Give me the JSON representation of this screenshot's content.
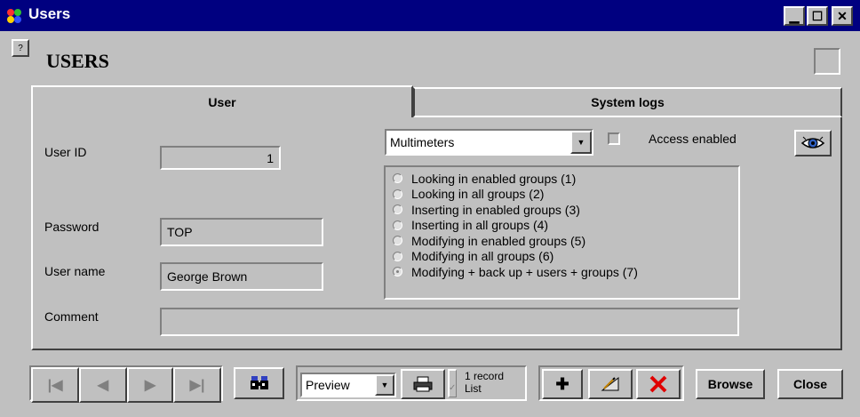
{
  "window": {
    "title": "Users"
  },
  "header": {
    "title": "USERS"
  },
  "tabs": [
    {
      "label": "User"
    },
    {
      "label": "System logs"
    }
  ],
  "form": {
    "user_id_label": "User ID",
    "user_id_value": "1",
    "password_label": "Password",
    "password_value": "TOP",
    "user_name_label": "User name",
    "user_name_value": "George Brown",
    "comment_label": "Comment",
    "comment_value": ""
  },
  "permissions": {
    "group_select_value": "Multimeters",
    "access_enabled_label": "Access enabled",
    "access_enabled_checked": false,
    "options": [
      {
        "label": "Looking in enabled groups (1)",
        "checked": false
      },
      {
        "label": "Looking in all groups (2)",
        "checked": false
      },
      {
        "label": "Inserting in enabled groups (3)",
        "checked": false
      },
      {
        "label": "Inserting in all groups (4)",
        "checked": false
      },
      {
        "label": "Modifying in enabled groups (5)",
        "checked": false
      },
      {
        "label": "Modifying in all groups (6)",
        "checked": false
      },
      {
        "label": "Modifying + back up + users + groups (7)",
        "checked": true
      }
    ]
  },
  "toolbar": {
    "report_select_value": "Preview",
    "print_scope_line1": "1 record",
    "print_scope_line2": "List",
    "browse_label": "Browse",
    "close_label": "Close"
  },
  "colors": {
    "titlebar": "#000080",
    "face": "#c0c0c0",
    "delete_icon": "#e00000"
  }
}
